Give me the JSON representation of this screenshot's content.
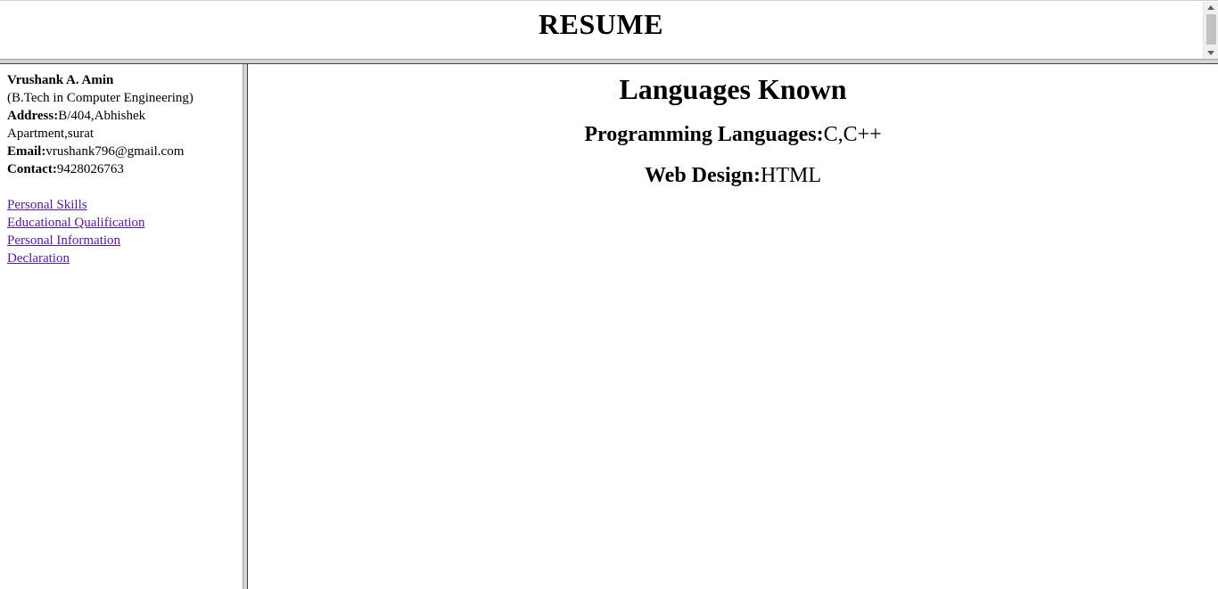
{
  "header": {
    "title": "RESUME"
  },
  "sidebar": {
    "name": "Vrushank A. Amin",
    "degree": "(B.Tech in Computer Engineering)",
    "address_label": "Address:",
    "address_value_1": "B/404,Abhishek",
    "address_value_2": "Apartment,surat",
    "email_label": "Email:",
    "email_value": "vrushank796@gmail.com",
    "contact_label": "Contact:",
    "contact_value": "9428026763",
    "links": [
      {
        "label": "Personal Skills"
      },
      {
        "label": "Educational Qualification"
      },
      {
        "label": "Personal Information"
      },
      {
        "label": "Declaration"
      }
    ]
  },
  "main": {
    "heading": "Languages Known",
    "programming_label": "Programming Languages:",
    "programming_value": "C,C++",
    "web_label": "Web Design:",
    "web_value": "HTML"
  },
  "colors": {
    "visited_link": "#551a8b",
    "frame_border": "#d4d4d4"
  }
}
